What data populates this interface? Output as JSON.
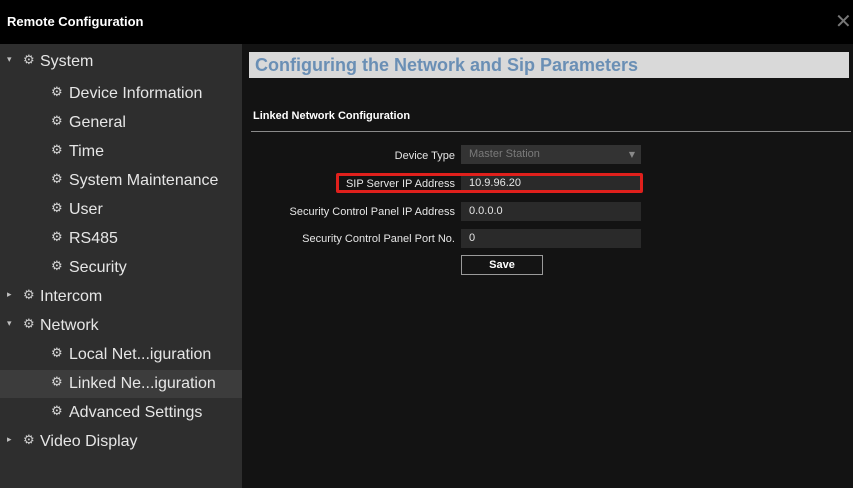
{
  "window": {
    "title": "Remote Configuration",
    "close_glyph": "✕"
  },
  "sidebar": {
    "items": [
      {
        "label": "System",
        "level": 0,
        "expanded": true,
        "icon": "gear-group-icon"
      },
      {
        "label": "Device Information",
        "level": 1,
        "icon": "gear-icon"
      },
      {
        "label": "General",
        "level": 1,
        "icon": "gear-icon"
      },
      {
        "label": "Time",
        "level": 1,
        "icon": "gear-icon"
      },
      {
        "label": "System Maintenance",
        "level": 1,
        "icon": "gear-icon"
      },
      {
        "label": "User",
        "level": 1,
        "icon": "gear-icon"
      },
      {
        "label": "RS485",
        "level": 1,
        "icon": "gear-icon"
      },
      {
        "label": "Security",
        "level": 1,
        "icon": "gear-icon"
      },
      {
        "label": "Intercom",
        "level": 0,
        "expanded": false,
        "icon": "gear-group-icon"
      },
      {
        "label": "Network",
        "level": 0,
        "expanded": true,
        "icon": "gear-group-icon"
      },
      {
        "label": "Local Net...iguration",
        "level": 1,
        "icon": "gear-icon"
      },
      {
        "label": "Linked Ne...iguration",
        "level": 1,
        "icon": "gear-icon",
        "selected": true
      },
      {
        "label": "Advanced Settings",
        "level": 1,
        "icon": "gear-icon"
      },
      {
        "label": "Video Display",
        "level": 0,
        "expanded": false,
        "icon": "gear-group-icon"
      }
    ]
  },
  "main": {
    "section_title": "Configuring the Network and Sip Parameters",
    "sub_title": "Linked Network Configuration",
    "form": {
      "device_type": {
        "label": "Device Type",
        "value": "Master Station"
      },
      "sip_server_ip": {
        "label": "SIP Server IP Address",
        "value": "10.9.96.20"
      },
      "security_panel_ip": {
        "label": "Security Control Panel IP Address",
        "value": "0.0.0.0"
      },
      "security_panel_port": {
        "label": "Security Control Panel Port No.",
        "value": "0"
      }
    },
    "save_label": "Save"
  },
  "colors": {
    "highlight": "#e0201c",
    "section_title": "#6a8fb5",
    "section_background": "#d9d9d9"
  }
}
